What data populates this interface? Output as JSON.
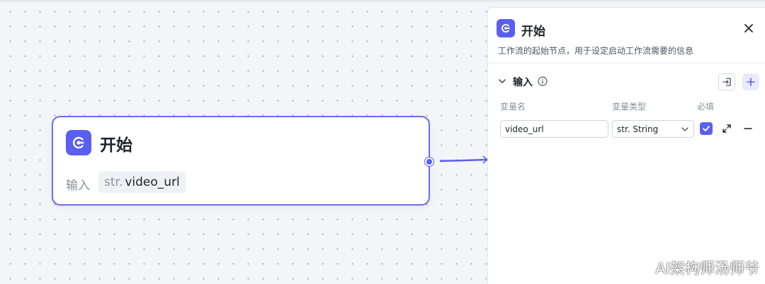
{
  "node": {
    "title": "开始",
    "input_label": "输入",
    "chip_type": "str.",
    "chip_name": "video_url"
  },
  "panel": {
    "title": "开始",
    "description": "工作流的起始节点，用于设定启动工作流需要的信息",
    "section_title": "输入",
    "columns": {
      "name": "变量名",
      "type": "变量类型",
      "required": "必填"
    },
    "variable": {
      "name": "video_url",
      "type_display": "str. String",
      "required": true
    }
  },
  "watermark": "AI架构师汤师爷",
  "colors": {
    "accent": "#5a5ff0",
    "node_border": "#6b6ee8"
  },
  "icons": {
    "node_icon": "start-icon",
    "close": "close-icon",
    "info": "info-icon",
    "import": "import-icon",
    "add": "plus-icon",
    "expand": "expand-icon",
    "remove": "minus-icon"
  }
}
